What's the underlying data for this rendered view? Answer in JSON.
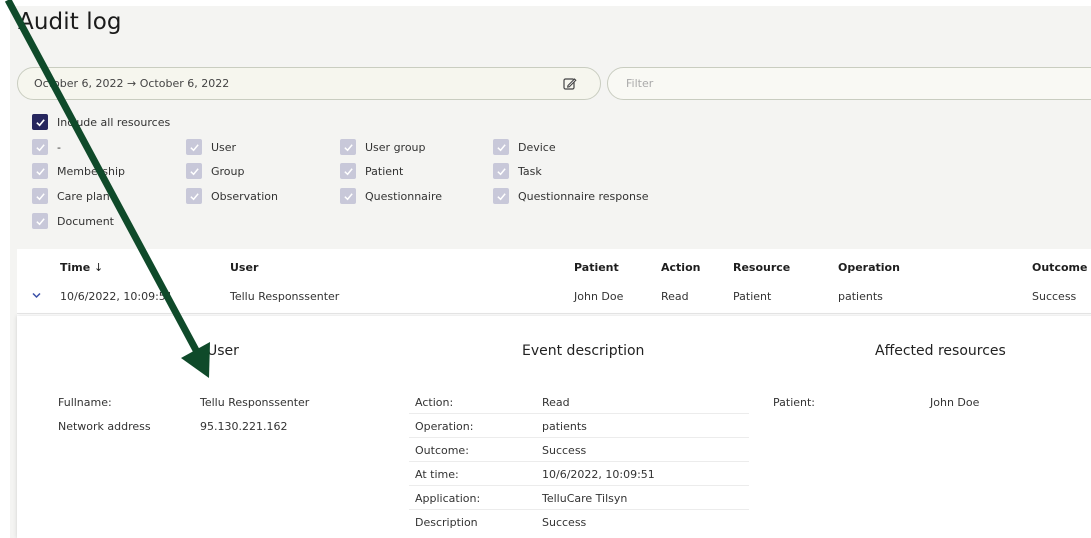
{
  "page": {
    "title": "Audit log"
  },
  "date_range": {
    "value": "October 6, 2022 → October 6, 2022",
    "icon": "edit-icon"
  },
  "filter": {
    "placeholder": "Filter"
  },
  "resources": {
    "include_all": "Include all resources",
    "items": [
      "-",
      "User",
      "User group",
      "Device",
      "Membership",
      "Group",
      "Patient",
      "Task",
      "Care plan",
      "Observation",
      "Questionnaire",
      "Questionnaire response",
      "Document"
    ]
  },
  "table": {
    "headers": {
      "time": "Time",
      "user": "User",
      "patient": "Patient",
      "action": "Action",
      "resource": "Resource",
      "operation": "Operation",
      "outcome": "Outcome"
    },
    "sort_icon": "↓",
    "row": {
      "time": "10/6/2022, 10:09:51",
      "user": "Tellu Responssenter",
      "patient": "John Doe",
      "action": "Read",
      "resource": "Patient",
      "operation": "patients",
      "outcome": "Success"
    }
  },
  "detail": {
    "user": {
      "title": "User",
      "fullname_label": "Fullname:",
      "fullname": "Tellu Responssenter",
      "network_label": "Network address",
      "network": "95.130.221.162"
    },
    "event": {
      "title": "Event description",
      "rows": [
        {
          "label": "Action:",
          "value": "Read"
        },
        {
          "label": "Operation:",
          "value": "patients"
        },
        {
          "label": "Outcome:",
          "value": "Success"
        },
        {
          "label": "At time:",
          "value": "10/6/2022, 10:09:51"
        },
        {
          "label": "Application:",
          "value": "TelluCare Tilsyn"
        },
        {
          "label": "Description",
          "value": "Success"
        }
      ]
    },
    "affected": {
      "title": "Affected resources",
      "label": "Patient:",
      "value": "John Doe"
    }
  },
  "colors": {
    "arrow": "#0f4a2a",
    "checkbox_dark": "#26265e",
    "checkbox_light": "#c8c8d9"
  }
}
